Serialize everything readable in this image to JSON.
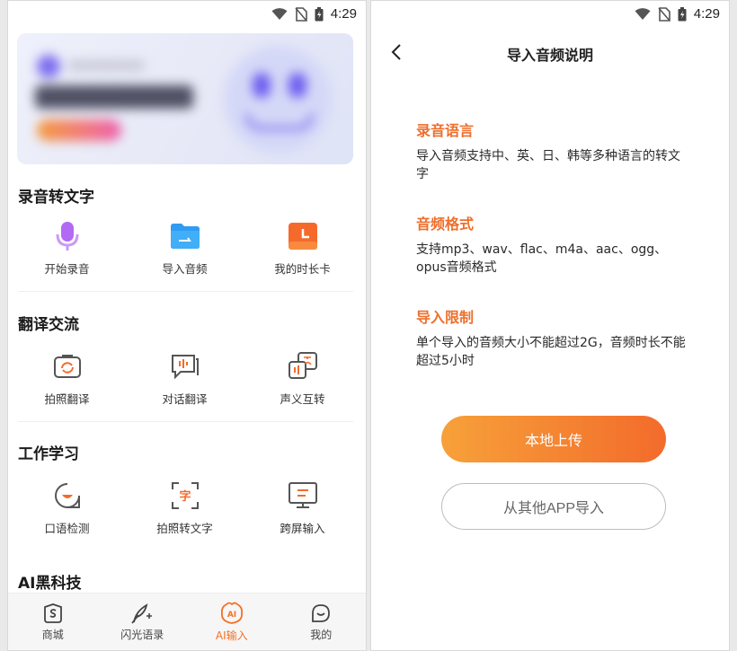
{
  "status": {
    "time": "4:29"
  },
  "home": {
    "sections": [
      {
        "title": "录音转文字",
        "items": [
          {
            "label": "开始录音",
            "icon": "microphone-icon"
          },
          {
            "label": "导入音频",
            "icon": "folder-icon"
          },
          {
            "label": "我的时长卡",
            "icon": "clock-card-icon"
          }
        ]
      },
      {
        "title": "翻译交流",
        "items": [
          {
            "label": "拍照翻译",
            "icon": "camera-translate-icon"
          },
          {
            "label": "对话翻译",
            "icon": "dialog-translate-icon"
          },
          {
            "label": "声义互转",
            "icon": "voice-text-convert-icon"
          }
        ]
      },
      {
        "title": "工作学习",
        "items": [
          {
            "label": "口语检测",
            "icon": "oral-check-icon"
          },
          {
            "label": "拍照转文字",
            "icon": "photo-to-text-icon"
          },
          {
            "label": "跨屏输入",
            "icon": "cross-screen-input-icon"
          }
        ]
      },
      {
        "title": "AI黑科技",
        "items": []
      }
    ],
    "tabs": [
      {
        "label": "商城",
        "icon": "shop-icon",
        "active": false
      },
      {
        "label": "闪光语录",
        "icon": "quill-icon",
        "active": false
      },
      {
        "label": "AI输入",
        "icon": "ai-icon",
        "active": true
      },
      {
        "label": "我的",
        "icon": "smile-icon",
        "active": false
      }
    ]
  },
  "import_page": {
    "title": "导入音频说明",
    "blocks": [
      {
        "heading": "录音语言",
        "text": "导入音频支持中、英、日、韩等多种语言的转文字"
      },
      {
        "heading": "音频格式",
        "text": "支持mp3、wav、flac、m4a、aac、ogg、opus音频格式"
      },
      {
        "heading": "导入限制",
        "text": "单个导入的音频大小不能超过2G，音频时长不能超过5小时"
      }
    ],
    "primary_button": "本地上传",
    "secondary_button": "从其他APP导入"
  },
  "colors": {
    "accent": "#f37126",
    "heading": "#ee6f2d",
    "button_start": "#f7a13a",
    "button_end": "#f36b2b"
  }
}
